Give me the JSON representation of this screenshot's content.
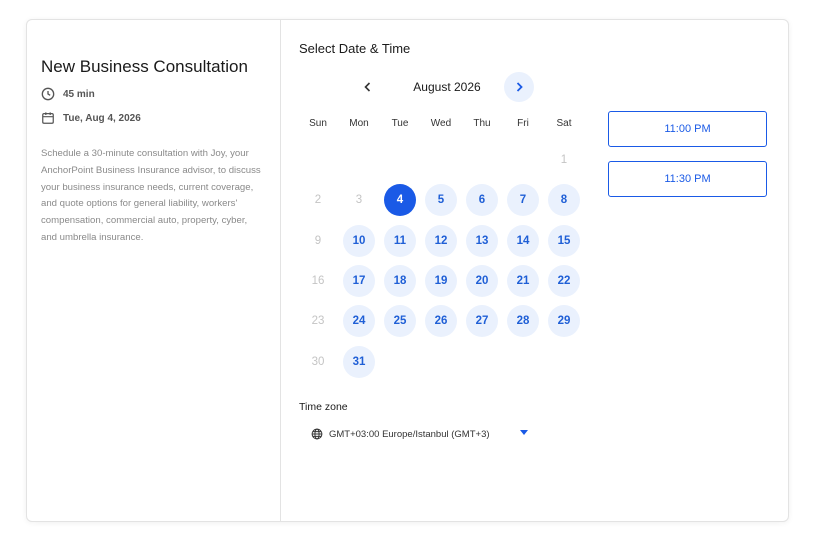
{
  "event": {
    "title": "New Business Consultation",
    "duration": "45 min",
    "date": "Tue, Aug 4, 2026",
    "description": "Schedule a 30-minute consultation with Joy, your AnchorPoint Business Insurance advisor, to discuss your business insurance needs, current coverage, and quote options for general liability, workers' compensation, commercial auto, property, cyber, and umbrella insurance."
  },
  "picker": {
    "heading": "Select Date & Time",
    "month_label": "August 2026",
    "weekdays": [
      "Sun",
      "Mon",
      "Tue",
      "Wed",
      "Thu",
      "Fri",
      "Sat"
    ],
    "days": [
      {
        "label": "1",
        "status": "disabled"
      },
      {
        "label": "2",
        "status": "disabled"
      },
      {
        "label": "3",
        "status": "disabled"
      },
      {
        "label": "4",
        "status": "selected"
      },
      {
        "label": "5",
        "status": "available"
      },
      {
        "label": "6",
        "status": "available"
      },
      {
        "label": "7",
        "status": "available"
      },
      {
        "label": "8",
        "status": "available"
      },
      {
        "label": "9",
        "status": "disabled"
      },
      {
        "label": "10",
        "status": "available"
      },
      {
        "label": "11",
        "status": "available"
      },
      {
        "label": "12",
        "status": "available"
      },
      {
        "label": "13",
        "status": "available"
      },
      {
        "label": "14",
        "status": "available"
      },
      {
        "label": "15",
        "status": "available"
      },
      {
        "label": "16",
        "status": "disabled"
      },
      {
        "label": "17",
        "status": "available"
      },
      {
        "label": "18",
        "status": "available"
      },
      {
        "label": "19",
        "status": "available"
      },
      {
        "label": "20",
        "status": "available"
      },
      {
        "label": "21",
        "status": "available"
      },
      {
        "label": "22",
        "status": "available"
      },
      {
        "label": "23",
        "status": "disabled"
      },
      {
        "label": "24",
        "status": "available"
      },
      {
        "label": "25",
        "status": "available"
      },
      {
        "label": "26",
        "status": "available"
      },
      {
        "label": "27",
        "status": "available"
      },
      {
        "label": "28",
        "status": "available"
      },
      {
        "label": "29",
        "status": "available"
      },
      {
        "label": "30",
        "status": "disabled"
      },
      {
        "label": "31",
        "status": "available"
      }
    ],
    "timezone_label": "Time zone",
    "timezone_value": "GMT+03:00 Europe/Istanbul (GMT+3)"
  },
  "time_slots": [
    "11:00 PM",
    "11:30 PM"
  ],
  "icons": {
    "duration": "clock-icon",
    "date": "calendar-icon",
    "prev": "chevron-left-icon",
    "next": "chevron-right-icon",
    "timezone": "globe-icon",
    "dropdown": "caret-down-icon"
  },
  "colors": {
    "accent": "#1a5ae6",
    "available_bg": "#eaf1fd",
    "available_text": "#1f5fd6",
    "disabled_text": "#c4c4c4"
  }
}
